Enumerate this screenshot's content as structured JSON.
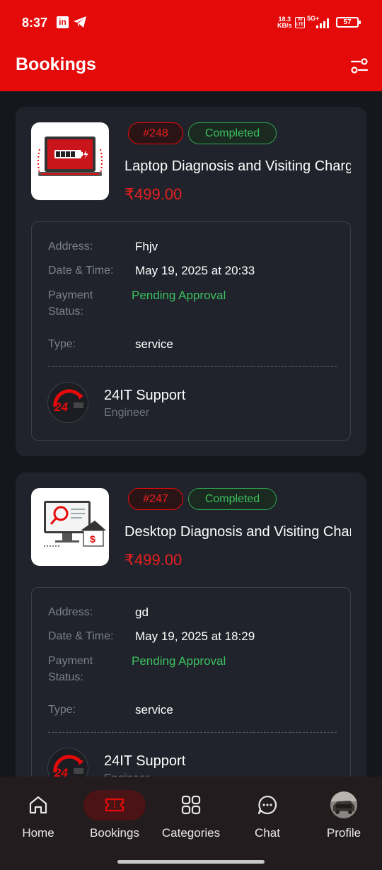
{
  "status_bar": {
    "time": "8:37",
    "net_speed_top": "18.3",
    "net_speed_bottom": "KB/s",
    "volte": "Vo LTE",
    "network": "5G+",
    "battery": "57"
  },
  "header": {
    "title": "Bookings",
    "filter_icon": "filter-sliders-icon"
  },
  "labels": {
    "address": "Address:",
    "date_time": "Date & Time:",
    "payment_status": "Payment Status:",
    "type": "Type:"
  },
  "bookings": [
    {
      "id": "#248",
      "status": "Completed",
      "title": "Laptop Diagnosis and Visiting Charges",
      "price": "₹499.00",
      "address": "Fhjv",
      "date_time": "May 19, 2025 at 20:33",
      "payment_status": "Pending Approval",
      "type": "service",
      "engineer_name": "24IT Support",
      "engineer_role": "Engineer",
      "thumb_icon": "laptop-battery-icon"
    },
    {
      "id": "#247",
      "status": "Completed",
      "title": "Desktop Diagnosis and Visiting Charges",
      "price": "₹499.00",
      "address": "gd",
      "date_time": "May 19, 2025 at 18:29",
      "payment_status": "Pending Approval",
      "type": "service",
      "engineer_name": "24IT Support",
      "engineer_role": "Engineer",
      "thumb_icon": "desktop-search-icon"
    }
  ],
  "nav": {
    "items": [
      {
        "label": "Home",
        "icon": "home-icon"
      },
      {
        "label": "Bookings",
        "icon": "ticket-icon"
      },
      {
        "label": "Categories",
        "icon": "grid-icon"
      },
      {
        "label": "Chat",
        "icon": "chat-icon"
      },
      {
        "label": "Profile",
        "icon": "avatar"
      }
    ],
    "active": "Bookings"
  },
  "colors": {
    "brand_red": "#e50a0a",
    "success_green": "#3cc060",
    "background": "#14171c",
    "card": "#20232b"
  }
}
